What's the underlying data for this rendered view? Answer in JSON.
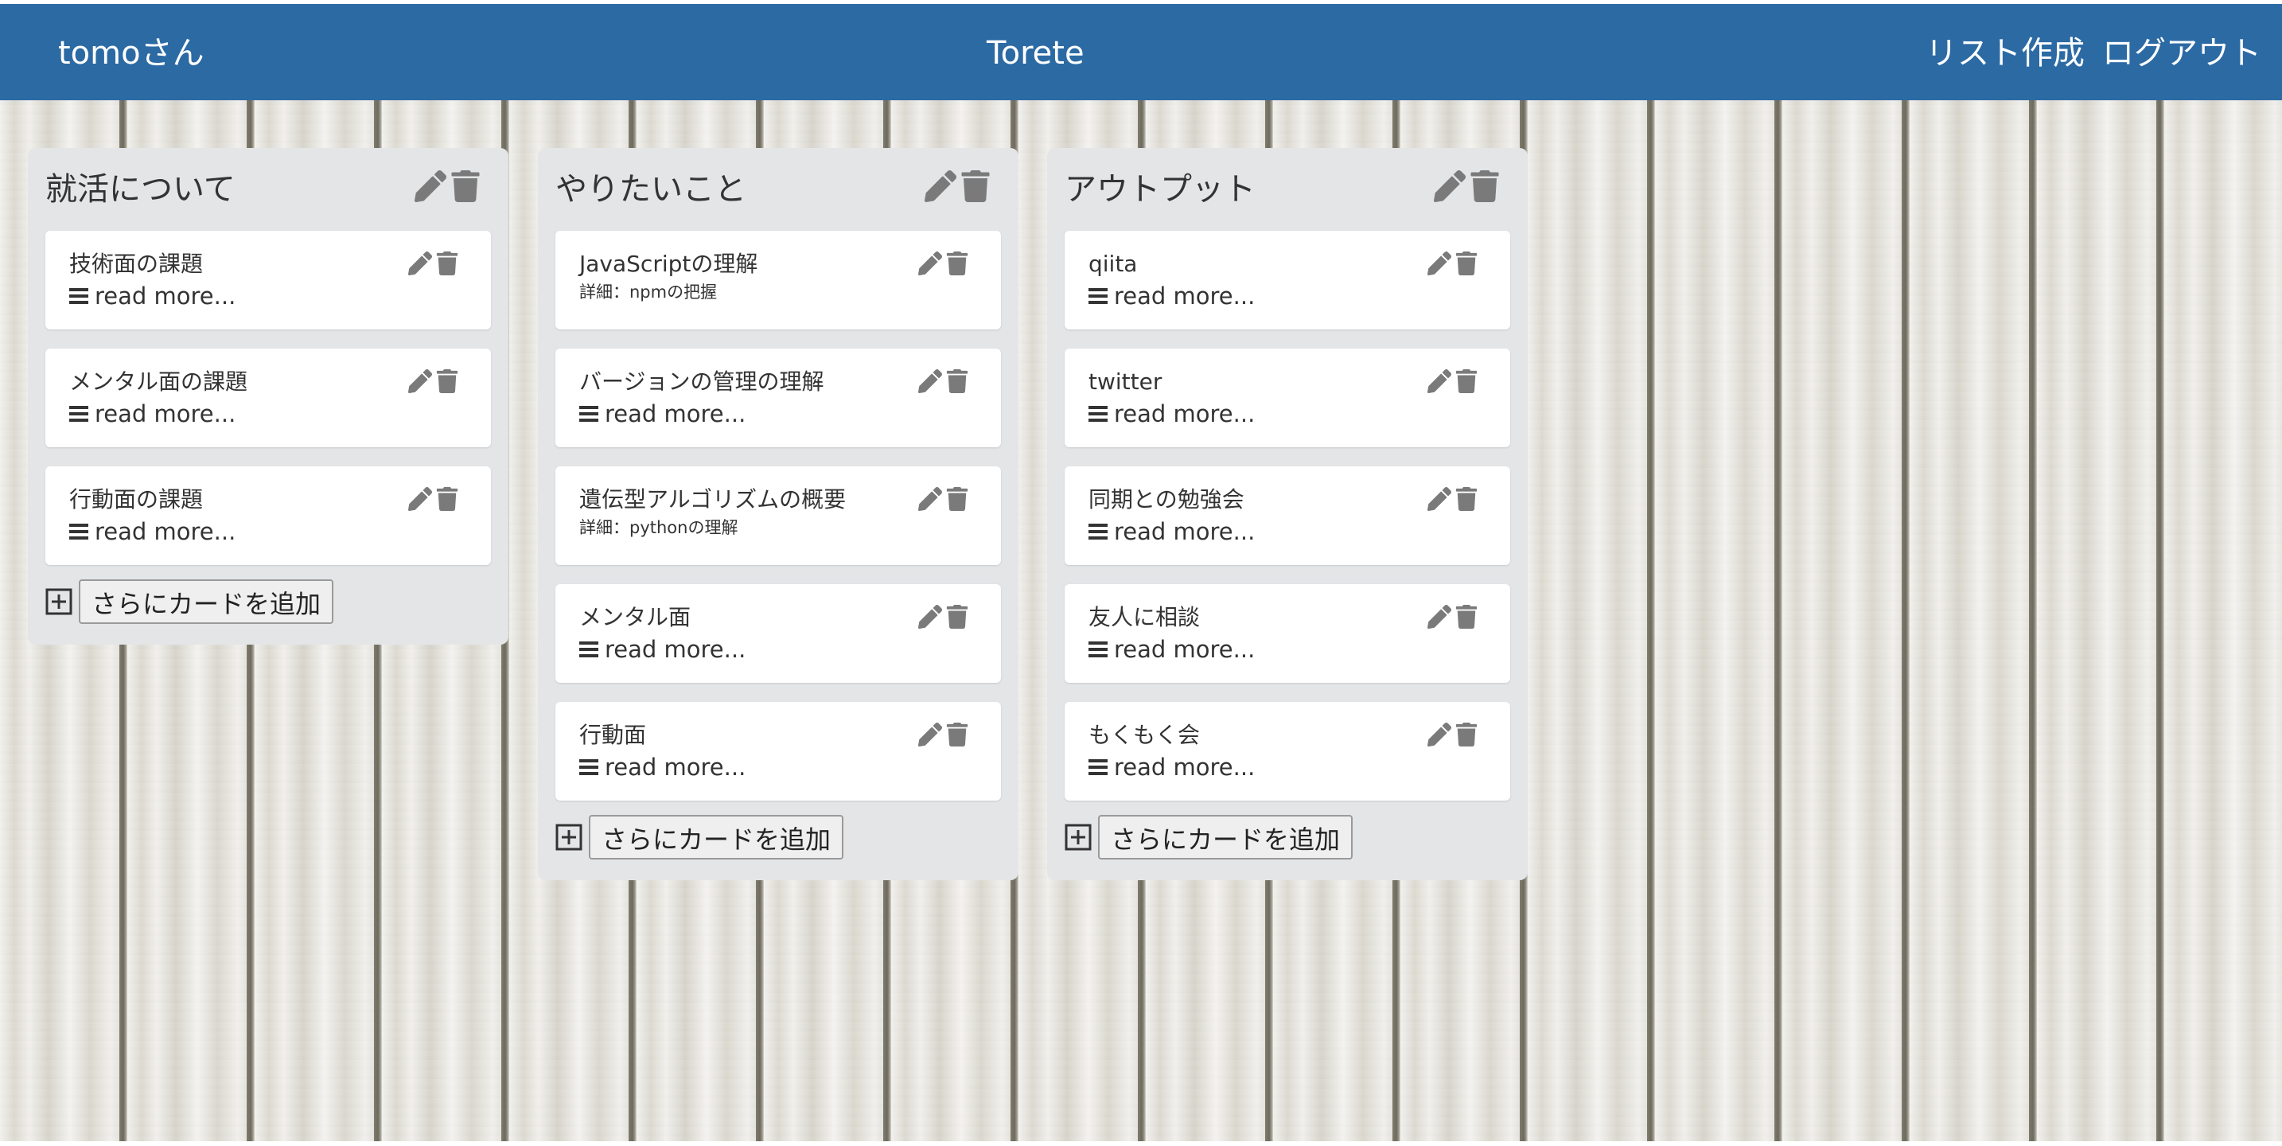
{
  "header": {
    "user": "tomoさん",
    "brand": "Torete",
    "create_list": "リスト作成",
    "logout": "ログアウト"
  },
  "common": {
    "read_more": "read more...",
    "add_card": "さらにカードを追加"
  },
  "colors": {
    "navbar": "#2c6aa4",
    "list_bg": "#e4e5e7",
    "icon": "#7a7a7a"
  },
  "icons": [
    "pencil-icon",
    "trash-icon",
    "bars-icon",
    "plus-square-icon"
  ],
  "lists": [
    {
      "title": "就活について",
      "cards": [
        {
          "title": "技術面の課題",
          "detail": ""
        },
        {
          "title": "メンタル面の課題",
          "detail": ""
        },
        {
          "title": "行動面の課題",
          "detail": ""
        }
      ]
    },
    {
      "title": "やりたいこと",
      "cards": [
        {
          "title": "JavaScriptの理解",
          "detail": "詳細：npmの把握"
        },
        {
          "title": "バージョンの管理の理解",
          "detail": ""
        },
        {
          "title": "遺伝型アルゴリズムの概要",
          "detail": "詳細：pythonの理解"
        },
        {
          "title": "メンタル面",
          "detail": ""
        },
        {
          "title": "行動面",
          "detail": ""
        }
      ]
    },
    {
      "title": "アウトプット",
      "cards": [
        {
          "title": "qiita",
          "detail": ""
        },
        {
          "title": "twitter",
          "detail": ""
        },
        {
          "title": "同期との勉強会",
          "detail": ""
        },
        {
          "title": "友人に相談",
          "detail": ""
        },
        {
          "title": "もくもく会",
          "detail": ""
        }
      ]
    }
  ]
}
